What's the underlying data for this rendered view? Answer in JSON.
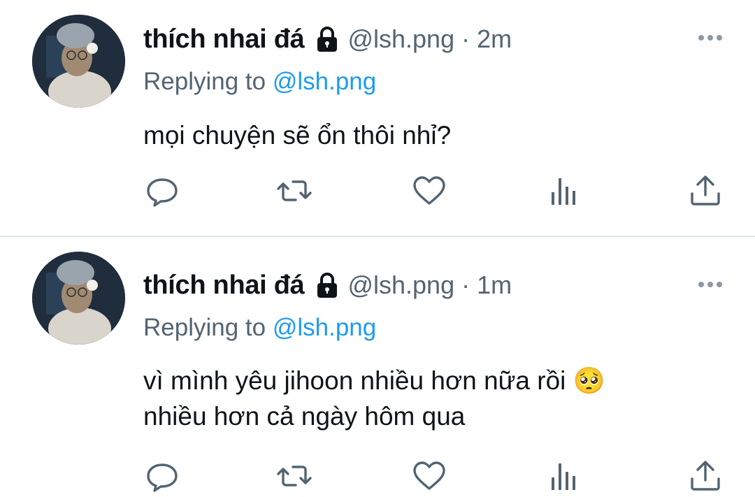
{
  "tweets": [
    {
      "author_name": "thích nhai đá",
      "handle": "@lsh.png",
      "separator": "·",
      "time": "2m",
      "replying_prefix": "Replying to",
      "replying_to": "@lsh.png",
      "text_lines": [
        "mọi chuyện sẽ ổn thôi nhỉ?"
      ]
    },
    {
      "author_name": "thích nhai đá",
      "handle": "@lsh.png",
      "separator": "·",
      "time": "1m",
      "replying_prefix": "Replying to",
      "replying_to": "@lsh.png",
      "text_lines": [
        "vì mình yêu jihoon nhiều hơn nữa rồi 🥺",
        "nhiều hơn cả ngày hôm qua"
      ]
    }
  ],
  "icons": {
    "author_badge": "lock-icon",
    "overflow": "more-horizontal-icon",
    "actions": [
      "reply-icon",
      "retweet-icon",
      "like-icon",
      "views-icon",
      "share-icon"
    ]
  },
  "colors": {
    "name": "#0f1419",
    "secondary": "#536471",
    "mention": "#1d9bf0",
    "divider": "#e1e8ed"
  }
}
